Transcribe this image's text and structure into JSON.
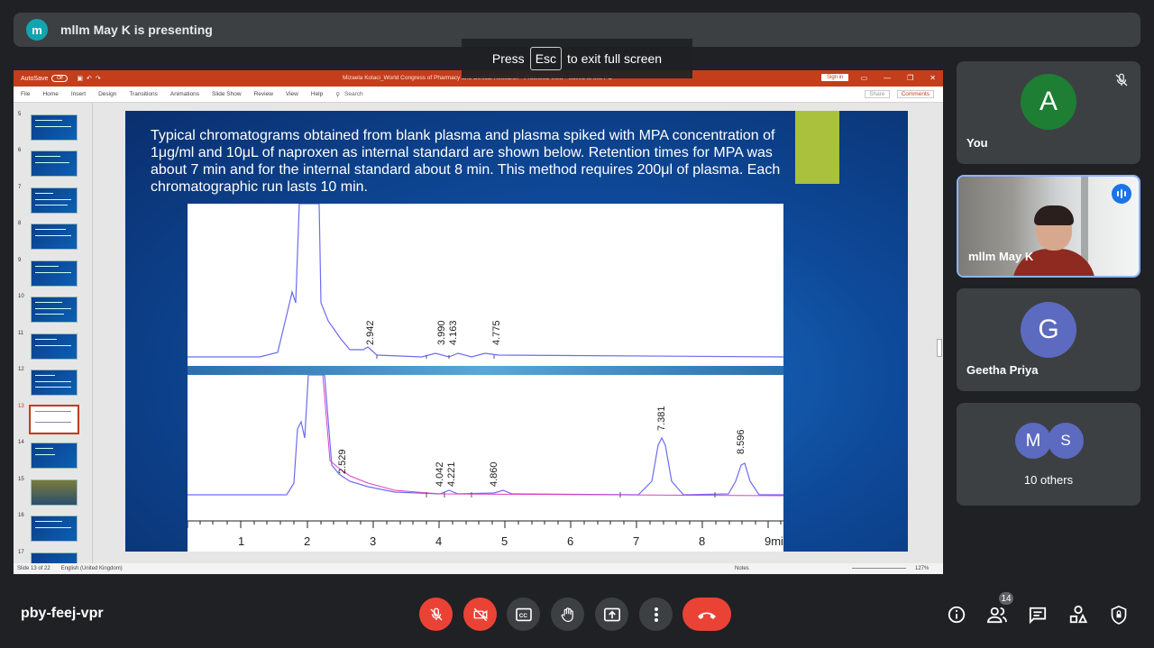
{
  "banner": {
    "avatar_letter": "m",
    "text": "mllm May K is presenting",
    "avatar_color": "#12a4af"
  },
  "toast": {
    "press": "Press",
    "key": "Esc",
    "rest": "to exit full screen"
  },
  "ppt": {
    "autosave": "AutoSave",
    "autosave_state": "Off",
    "doc_title": "Mizaela Kolaci_World Congress of Pharmacy and Clinical Research - Protected View - Saved to this PC",
    "sign_in": "Sign in",
    "tabs": [
      "File",
      "Home",
      "Insert",
      "Design",
      "Transitions",
      "Animations",
      "Slide Show",
      "Review",
      "View",
      "Help"
    ],
    "search": "Search",
    "share": "Share",
    "comments": "Comments",
    "thumb_numbers": [
      "5",
      "6",
      "7",
      "8",
      "9",
      "10",
      "11",
      "12",
      "13",
      "14",
      "15",
      "16",
      "17"
    ],
    "selected_slide": "13",
    "status_slide": "Slide 13 of 22",
    "status_lang": "English (United Kingdom)",
    "status_notes": "Notes",
    "status_zoom": "127%",
    "accent": "#c43e1c"
  },
  "slide": {
    "caption": "Typical chromatograms obtained from blank plasma and plasma spiked with MPA concentration of 1μg/ml and 10μL of naproxen as internal standard are shown below. Retention times for MPA was about 7 min and for the internal standard about 8 min. This method requires 200μl of plasma. Each chromatographic run lasts 10 min.",
    "top_peaks": [
      "2.942",
      "3.990",
      "4.163",
      "4.775"
    ],
    "bottom_peaks": [
      "2.529",
      "4.042",
      "4.221",
      "4.860",
      "7.381",
      "8.596"
    ],
    "axis_ticks": [
      "1",
      "2",
      "3",
      "4",
      "5",
      "6",
      "7",
      "8",
      "9min"
    ]
  },
  "participants": {
    "you": {
      "letter": "A",
      "name": "You",
      "color": "#1e7e34"
    },
    "presenter": {
      "name": "mllm May K"
    },
    "geetha": {
      "letter": "G",
      "name": "Geetha Priya",
      "color": "#5c6bc0"
    },
    "others": {
      "letters": [
        "M",
        "S"
      ],
      "caption": "10 others",
      "colors": [
        "#5c6bc0",
        "#5c6bc0"
      ]
    }
  },
  "bottom": {
    "meeting_code": "pby-feej-vpr",
    "people_count": "14"
  }
}
